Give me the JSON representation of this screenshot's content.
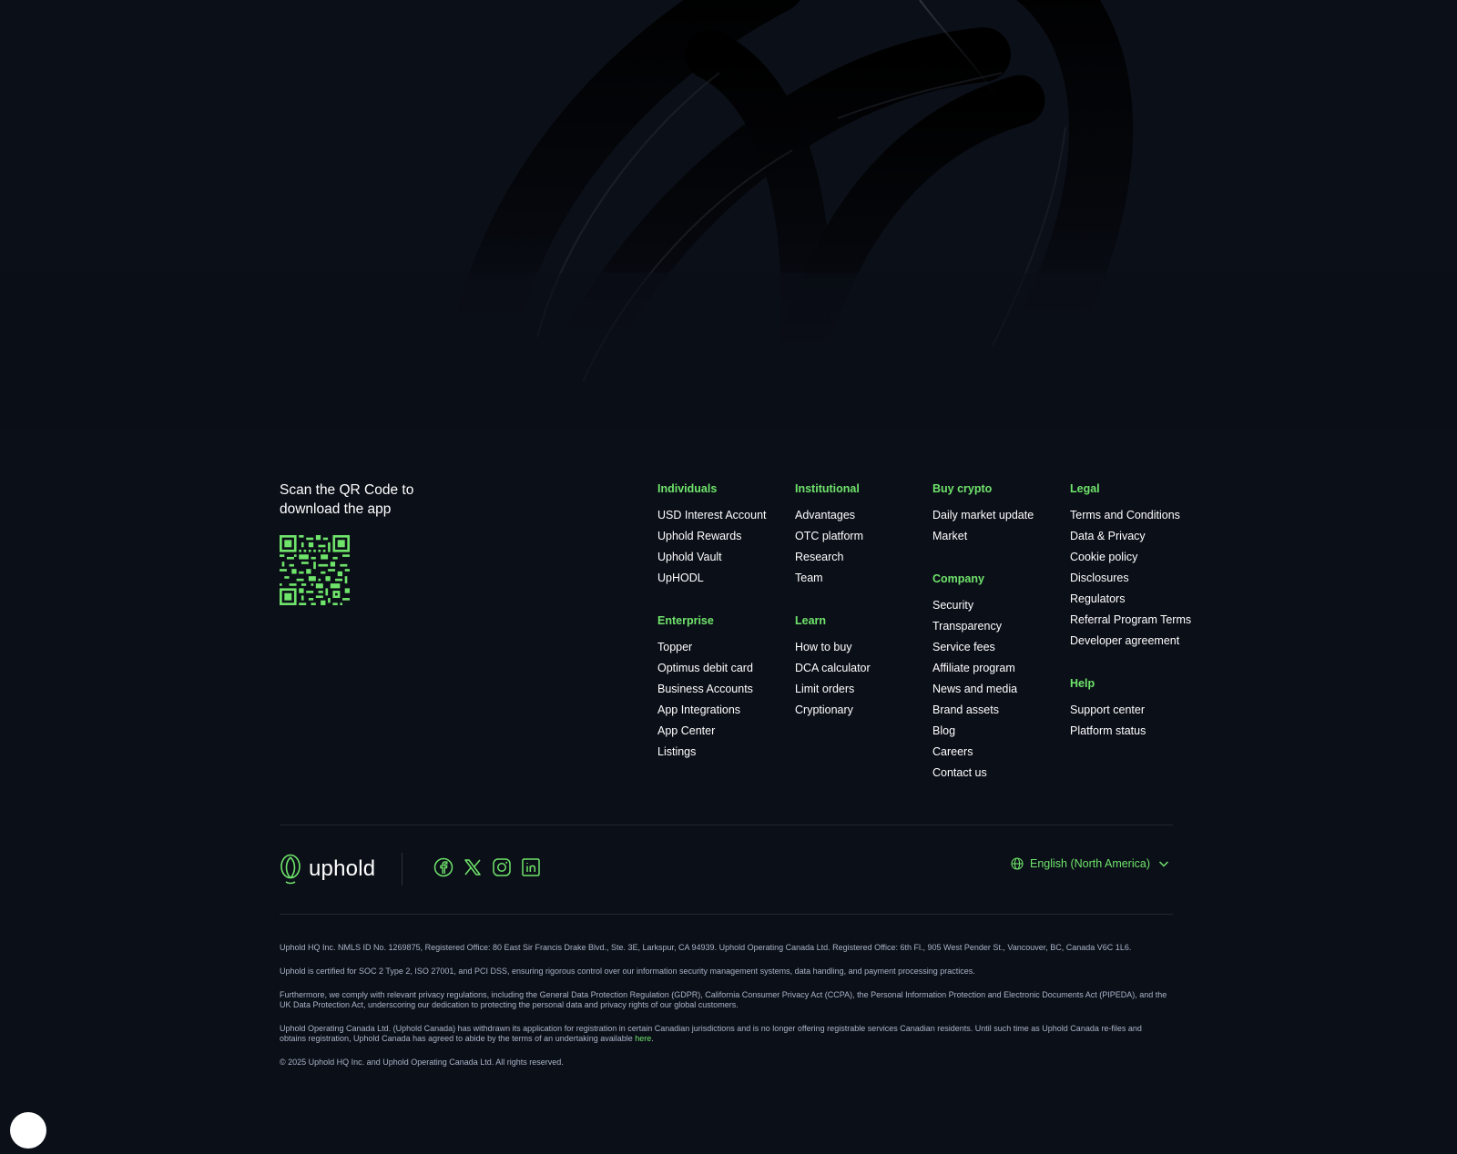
{
  "qr": {
    "text": "Scan the QR Code to download the app",
    "icon": "qr-code-icon"
  },
  "columns": {
    "individuals": {
      "title": "Individuals",
      "links": [
        "USD Interest Account",
        "Uphold Rewards",
        "Uphold Vault",
        "UpHODL"
      ]
    },
    "enterprise": {
      "title": "Enterprise",
      "links": [
        "Topper",
        "Optimus debit card",
        "Business Accounts",
        "App Integrations",
        "App Center",
        "Listings"
      ]
    },
    "institutional": {
      "title": "Institutional",
      "links": [
        "Advantages",
        "OTC platform",
        "Research",
        "Team"
      ]
    },
    "learn": {
      "title": "Learn",
      "links": [
        "How to buy",
        "DCA calculator",
        "Limit orders",
        "Cryptionary"
      ]
    },
    "buy_crypto": {
      "title": "Buy crypto",
      "links": [
        "Daily market update",
        "Market"
      ]
    },
    "company": {
      "title": "Company",
      "links": [
        "Security",
        "Transparency",
        "Service fees",
        "Affiliate program",
        "News and media",
        "Brand assets",
        "Blog",
        "Careers",
        "Contact us"
      ]
    },
    "legal": {
      "title": "Legal",
      "links": [
        "Terms and Conditions",
        "Data & Privacy",
        "Cookie policy",
        "Disclosures",
        "Regulators",
        "Referral Program Terms",
        "Developer agreement"
      ]
    },
    "help": {
      "title": "Help",
      "links": [
        "Support center",
        "Platform status"
      ]
    }
  },
  "brand": {
    "name": "uphold",
    "socials": [
      "facebook-icon",
      "x-icon",
      "instagram-icon",
      "linkedin-icon"
    ]
  },
  "language": {
    "label": "English (North America)"
  },
  "legal_text": {
    "p1": "Uphold HQ Inc. NMLS ID No. 1269875, Registered Office: 80 East Sir Francis Drake Blvd., Ste. 3E, Larkspur, CA 94939. Uphold Operating Canada Ltd. Registered Office: 6th Fl., 905 West Pender St., Vancouver, BC, Canada V6C 1L6.",
    "p2": "Uphold is certified for SOC 2 Type 2, ISO 27001, and PCI DSS, ensuring rigorous control over our information security management systems, data handling, and payment processing practices.",
    "p3": "Furthermore, we comply with relevant privacy regulations, including the General Data Protection Regulation (GDPR), California Consumer Privacy Act (CCPA), the Personal Information Protection and Electronic Documents Act (PIPEDA), and the UK Data Protection Act, underscoring our dedication to protecting the personal data and privacy rights of our global customers.",
    "p4": "Uphold Operating Canada Ltd. (Uphold Canada) has withdrawn its application for registration in certain Canadian jurisdictions and is no longer offering registrable services Canadian residents. Until such time as Uphold Canada re-files and obtains registration, Uphold Canada has agreed to abide by the terms of an undertaking available ",
    "p4_link": "here",
    "p4_end": ".",
    "copyright": "© 2025 Uphold HQ Inc. and Uphold Operating Canada Ltd. All rights reserved."
  },
  "colors": {
    "background": "#0b0f18",
    "accent": "#6fe46b",
    "text": "#ffffff",
    "muted": "#aab3c7"
  }
}
